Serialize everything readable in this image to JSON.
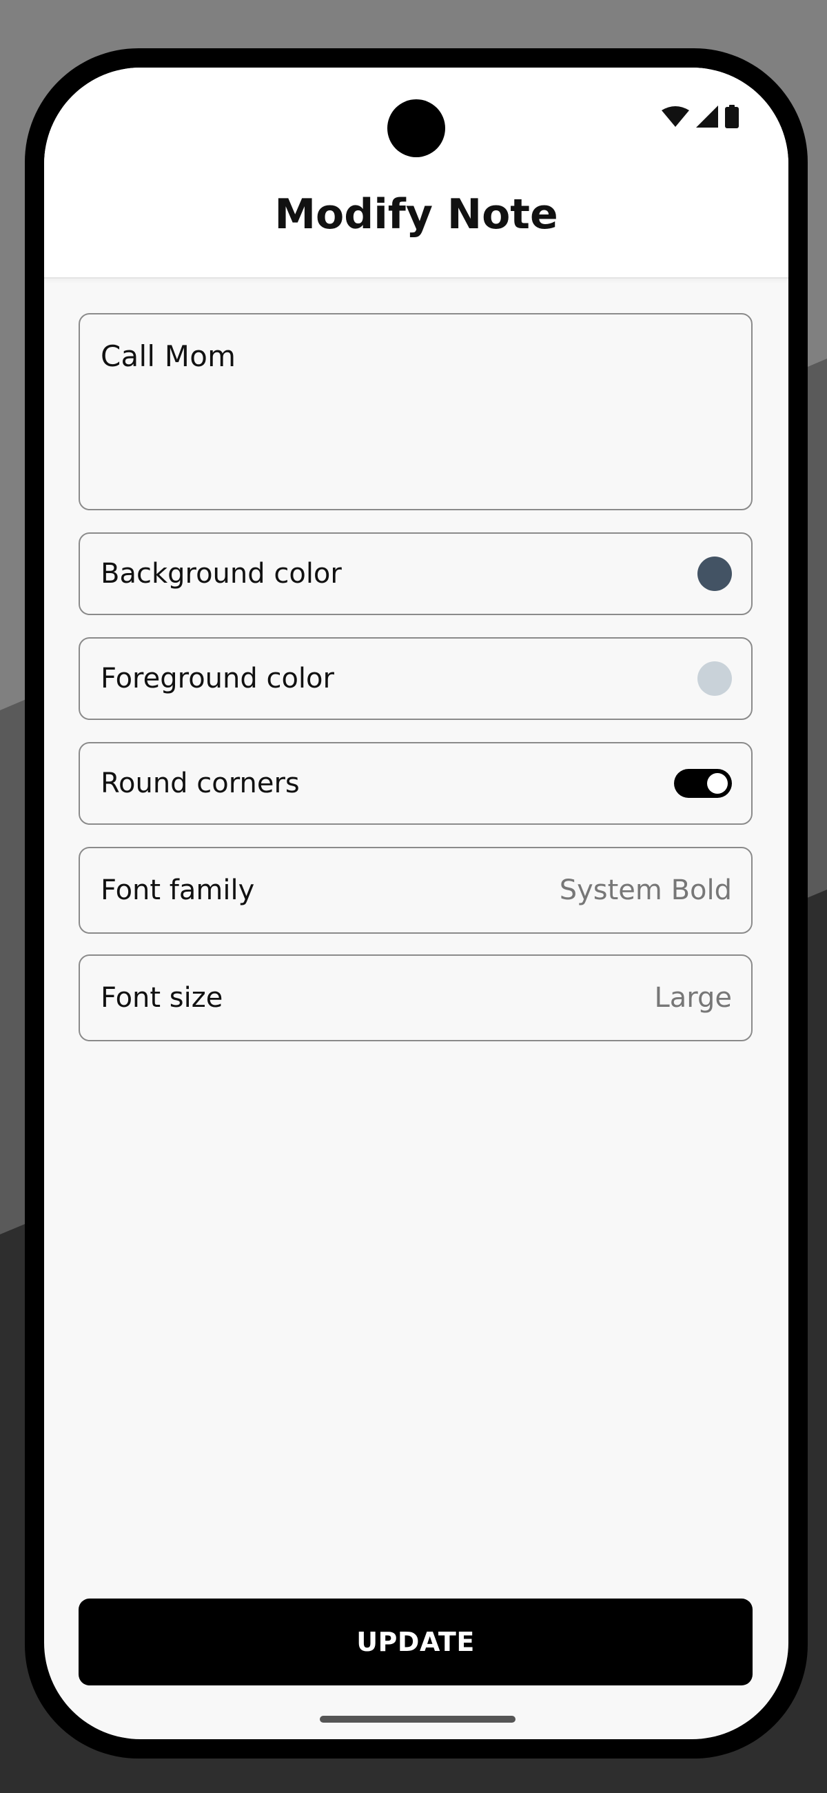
{
  "header": {
    "title": "Modify Note"
  },
  "status_bar": {
    "icons": [
      "wifi-icon",
      "cellular-signal-icon",
      "battery-icon"
    ]
  },
  "note": {
    "text": "Call Mom"
  },
  "settings": {
    "background_color": {
      "label": "Background color",
      "value_color": "#435364"
    },
    "foreground_color": {
      "label": "Foreground color",
      "value_color": "#c9d2d9"
    },
    "round_corners": {
      "label": "Round corners",
      "enabled": true
    },
    "font_family": {
      "label": "Font family",
      "value": "System Bold"
    },
    "font_size": {
      "label": "Font size",
      "value": "Large"
    }
  },
  "actions": {
    "update_label": "UPDATE"
  },
  "colors": {
    "accent": "#000000",
    "screen_background": "#f8f8f8",
    "header_background": "#ffffff",
    "field_border": "#8a8a8a",
    "secondary_text": "#777777"
  }
}
